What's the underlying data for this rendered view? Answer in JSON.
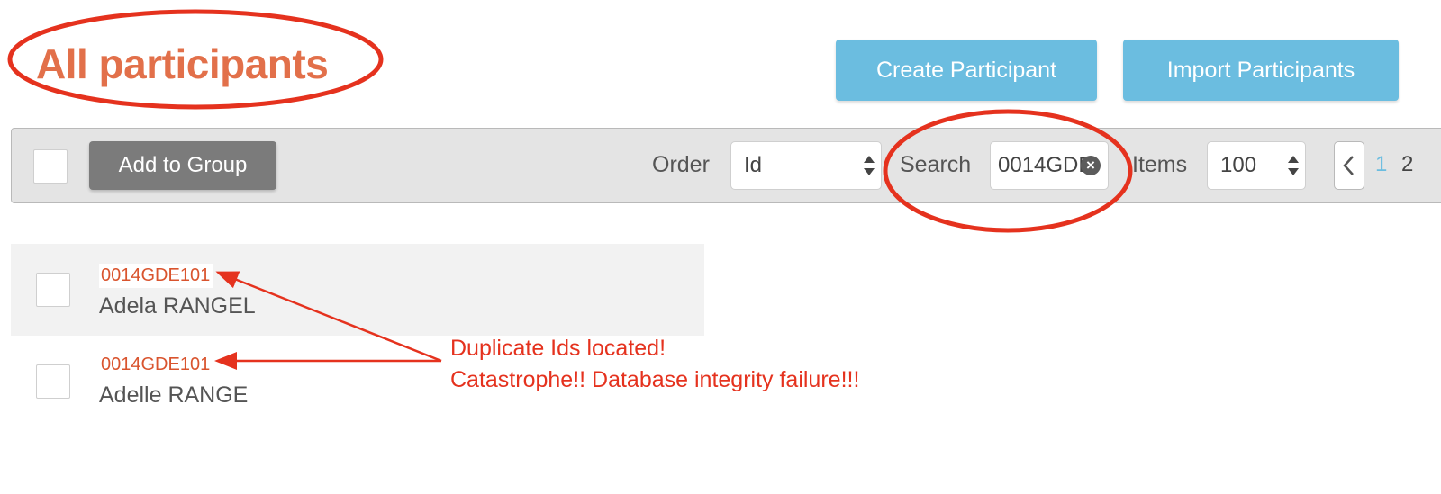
{
  "header": {
    "title": "All participants",
    "create_button": "Create Participant",
    "import_button": "Import Participants"
  },
  "toolbar": {
    "add_to_group": "Add to Group",
    "order_label": "Order",
    "order_value": "Id",
    "search_label": "Search",
    "search_value": "0014GDE",
    "items_label": "Items",
    "items_value": "100",
    "pages": [
      "1",
      "2"
    ]
  },
  "participants": [
    {
      "id": "0014GDE101",
      "name": "Adela RANGEL",
      "highlighted": true
    },
    {
      "id": "0014GDE101",
      "name": "Adelle RANGE",
      "highlighted": false
    }
  ],
  "annotation": {
    "line1": "Duplicate Ids located!",
    "line2": "Catastrophe!! Database integrity failure!!!",
    "color": "#e5321e"
  },
  "colors": {
    "title": "#e2704a",
    "primary_button": "#6bbde0",
    "group_button": "#7b7b7b",
    "id_text": "#d9542e"
  }
}
